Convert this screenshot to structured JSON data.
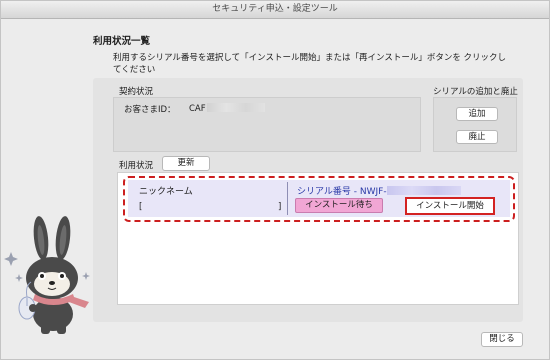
{
  "window": {
    "title": "セキュリティ申込・設定ツール"
  },
  "heading": "利用状況一覧",
  "instruction": "利用するシリアル番号を選択して「インストール開始」または「再インストール」ボタンを クリックしてください",
  "contract": {
    "label": "契約状況",
    "customer_label": "お客さまID：",
    "customer_id": "CAF"
  },
  "serial_panel": {
    "label": "シリアルの追加と廃止",
    "add_button": "追加",
    "remove_button": "廃止"
  },
  "usage": {
    "label": "利用状況",
    "refresh_button": "更新",
    "nickname_header": "ニックネーム",
    "nickname_open": "[",
    "nickname_close": "]",
    "serial_prefix": "シリアル番号 - NWJF-",
    "status_badge": "インストール待ち",
    "install_button": "インストール開始"
  },
  "footer": {
    "close_button": "閉じる"
  },
  "colors": {
    "dashed_outline": "#cc1f1f",
    "serial_text": "#2b3aa8",
    "status_badge": "#f1a6d4",
    "row_bg": "#e8e6f8"
  }
}
